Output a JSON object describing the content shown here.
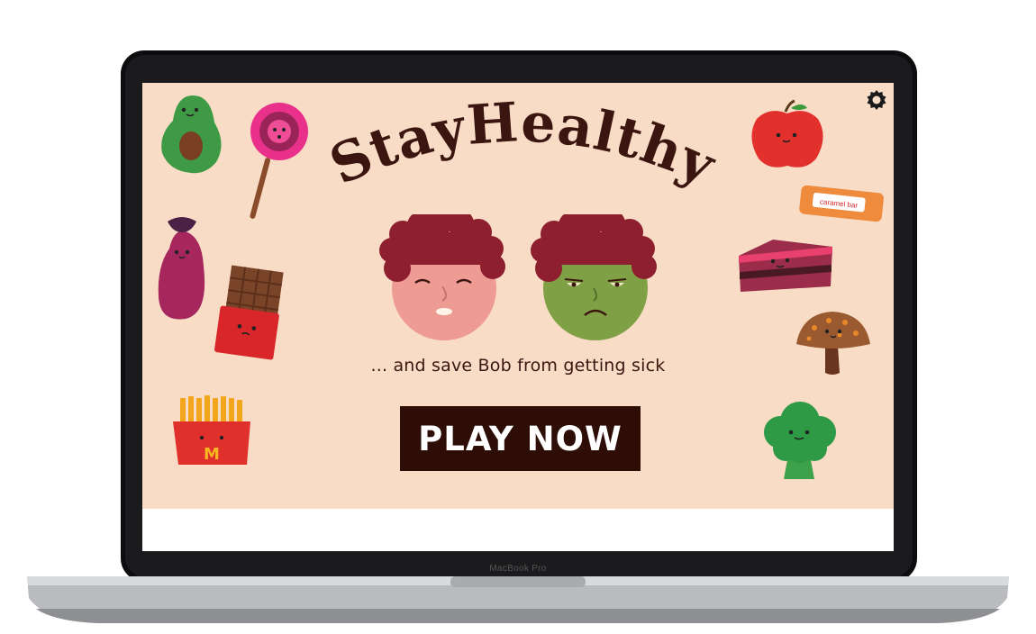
{
  "laptop": {
    "brand_label": "MacBook Pro"
  },
  "game": {
    "title": "StayHealthy",
    "tagline": "... and save Bob from getting sick",
    "play_label": "PLAY NOW",
    "caramel_label": "caramel bar",
    "fries_logo": "M"
  },
  "colors": {
    "background": "#f8dcc6",
    "title": "#3b1510",
    "button": "#2e0d07",
    "healthy_face": "#ee9b94",
    "sick_face": "#7fa044",
    "hair": "#8e1f2f"
  },
  "icons": {
    "settings": "gear-icon"
  }
}
